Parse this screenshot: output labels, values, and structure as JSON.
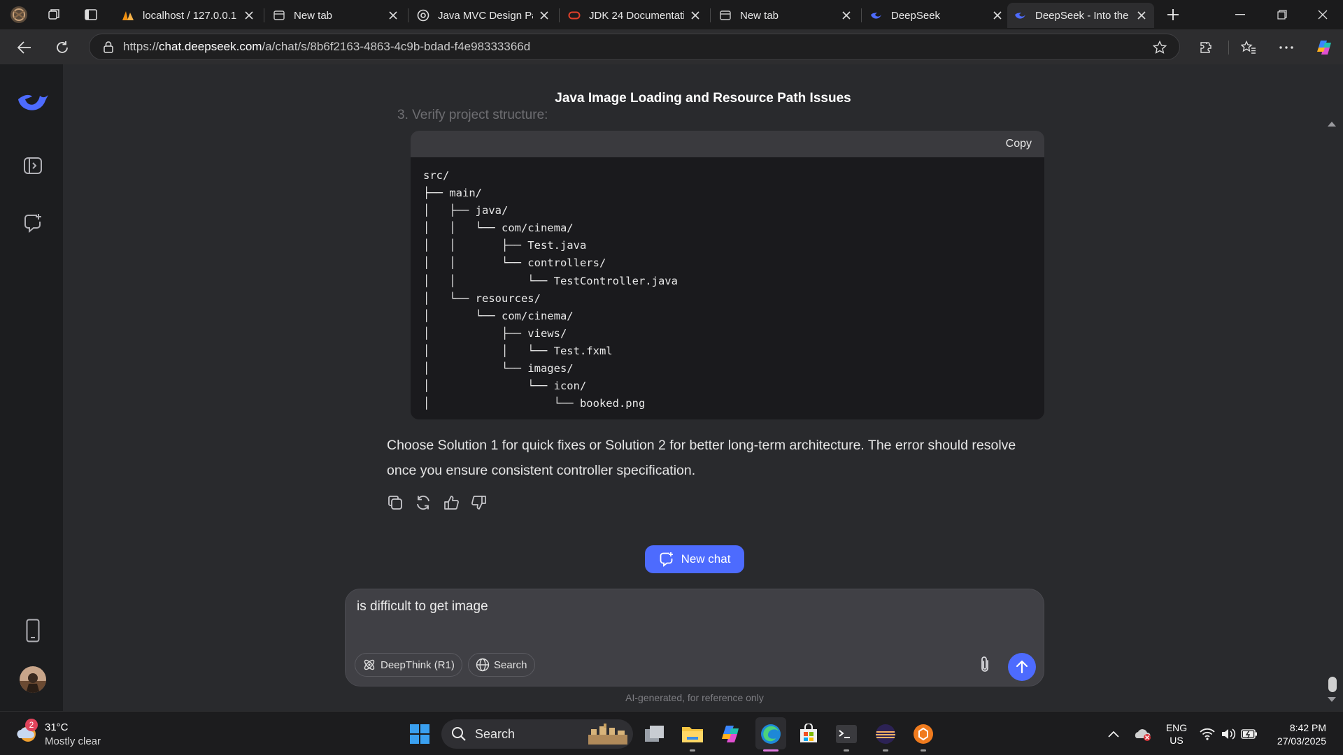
{
  "browser": {
    "tabs": [
      {
        "title": "localhost / 127.0.0.1",
        "favicon": "phpmyadmin-icon",
        "active": false
      },
      {
        "title": "New tab",
        "favicon": "newtab-icon",
        "active": false
      },
      {
        "title": "Java MVC Design Pat",
        "favicon": "chatgpt-icon",
        "active": false
      },
      {
        "title": "JDK 24 Documentati",
        "favicon": "oracle-icon",
        "active": false
      },
      {
        "title": "New tab",
        "favicon": "newtab-icon",
        "active": false
      },
      {
        "title": "DeepSeek",
        "favicon": "deepseek-icon",
        "active": false
      },
      {
        "title": "DeepSeek - Into the",
        "favicon": "deepseek-icon",
        "active": true
      }
    ],
    "url_prefix": "https://",
    "url_host": "chat.deepseek.com",
    "url_path": "/a/chat/s/8b6f2163-4863-4c9b-bdad-f4e98333366d"
  },
  "chat": {
    "title": "Java Image Loading and Resource Path Issues",
    "faded_line": "3. Verify project structure:",
    "code": {
      "copy_label": "Copy",
      "lines": [
        "src/",
        "├── main/",
        "│   ├── java/",
        "│   │   └── com/cinema/",
        "│   │       ├── Test.java",
        "│   │       └── controllers/",
        "│   │           └── TestController.java",
        "│   └── resources/",
        "│       └── com/cinema/",
        "│           ├── views/",
        "│           │   └── Test.fxml",
        "│           └── images/",
        "│               └── icon/",
        "│                   └── booked.png"
      ]
    },
    "answer": "Choose Solution 1 for quick fixes or Solution 2 for better long-term architecture. The error should resolve once you ensure consistent controller specification.",
    "new_chat_label": "New chat",
    "composer": {
      "value": "is difficult to get image",
      "deepthink_label": "DeepThink (R1)",
      "search_label": "Search"
    },
    "disclaimer": "AI-generated, for reference only"
  },
  "taskbar": {
    "weather_temp": "31°C",
    "weather_desc": "Mostly clear",
    "weather_badge": "2",
    "search_label": "Search",
    "lang_top": "ENG",
    "lang_bottom": "US",
    "time": "8:42 PM",
    "date": "27/03/2025"
  },
  "colors": {
    "accent": "#4d6bfe",
    "page_bg": "#292a2d",
    "rail_bg": "#1c1d1f",
    "code_bg": "#1a1a1d"
  }
}
